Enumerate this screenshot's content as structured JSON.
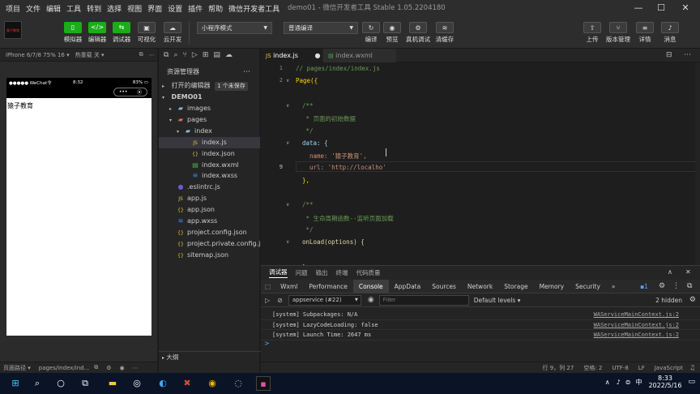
{
  "menu": [
    "项目",
    "文件",
    "编辑",
    "工具",
    "转到",
    "选择",
    "视图",
    "界面",
    "设置",
    "插件",
    "帮助",
    "微信开发者工具"
  ],
  "window_title": "demo01 - 微信开发者工具 Stable 1.05.2204180",
  "window_controls": {
    "minimize": "—",
    "maximize": "☐",
    "close": "✕"
  },
  "toolbar": {
    "logo_text": "猿子教育",
    "simulator": "模拟器",
    "editor": "编辑器",
    "debugger": "调试器",
    "visual": "可视化",
    "cloud": "云开发",
    "mode_select": "小程序模式",
    "compile_select": "普通编译",
    "compile": "编译",
    "preview": "预览",
    "remote_debug": "真机调试",
    "clear_cache": "清缓存",
    "upload": "上传",
    "version": "版本管理",
    "details": "详情",
    "messages": "消息"
  },
  "simulator": {
    "device": "iPhone 6/7/8 75% 16 ▾",
    "hot_reload": "热重载 关 ▾",
    "status_left": "●●●●● WeChat令",
    "status_time": "8:32",
    "status_battery": "83% ▭",
    "capsule_more": "•••",
    "capsule_close": "⦿",
    "content_text": "猿子教育",
    "page_path_label": "页面路径 ▾",
    "page_path": "pages/index/ind..."
  },
  "explorer": {
    "title": "资源管理器",
    "open_editors": "打开的编辑器",
    "unsaved_badge": "1 个未保存",
    "project": "DEMO01",
    "outline": "大纲",
    "items": [
      {
        "name": "images",
        "depth": 1,
        "kind": "folder",
        "arrow": "▸"
      },
      {
        "name": "pages",
        "depth": 1,
        "kind": "folder-red",
        "arrow": "▾"
      },
      {
        "name": "index",
        "depth": 2,
        "kind": "folder",
        "arrow": "▾"
      },
      {
        "name": "index.js",
        "depth": 3,
        "kind": "js",
        "arrow": ""
      },
      {
        "name": "index.json",
        "depth": 3,
        "kind": "json",
        "arrow": ""
      },
      {
        "name": "index.wxml",
        "depth": 3,
        "kind": "wxml",
        "arrow": ""
      },
      {
        "name": "index.wxss",
        "depth": 3,
        "kind": "wxss",
        "arrow": ""
      },
      {
        "name": ".eslintrc.js",
        "depth": 1,
        "kind": "eslint",
        "arrow": ""
      },
      {
        "name": "app.js",
        "depth": 1,
        "kind": "js",
        "arrow": ""
      },
      {
        "name": "app.json",
        "depth": 1,
        "kind": "json",
        "arrow": ""
      },
      {
        "name": "app.wxss",
        "depth": 1,
        "kind": "wxss",
        "arrow": ""
      },
      {
        "name": "project.config.json",
        "depth": 1,
        "kind": "json",
        "arrow": ""
      },
      {
        "name": "project.private.config.js...",
        "depth": 1,
        "kind": "json",
        "arrow": ""
      },
      {
        "name": "sitemap.json",
        "depth": 1,
        "kind": "json",
        "arrow": ""
      }
    ]
  },
  "editor": {
    "tabs": [
      {
        "label": "index.js",
        "active": true,
        "dirty": "●"
      },
      {
        "label": "index.wxml",
        "active": false,
        "dirty": ""
      }
    ],
    "line_numbers": [
      "1",
      "2",
      "",
      "",
      "",
      "",
      "",
      "",
      "9",
      "",
      "",
      "",
      "",
      "",
      "",
      "",
      ""
    ],
    "lines": [
      {
        "text": "// pages/index/index.js",
        "cls": "c-cm",
        "indent": 0
      },
      {
        "text": "Page({",
        "cls": "c-y",
        "indent": 0
      },
      {
        "text": "",
        "cls": "",
        "indent": 0
      },
      {
        "text": "/**",
        "cls": "c-cm",
        "indent": 1
      },
      {
        "text": " * 页面的初始数据",
        "cls": "c-cm",
        "indent": 1
      },
      {
        "text": " */",
        "cls": "c-cm",
        "indent": 1
      },
      {
        "text": "data: {",
        "cls": "c-key",
        "indent": 1
      },
      {
        "text": "name: '猿子教育',",
        "cls": "c-str",
        "indent": 2
      },
      {
        "text": "url: 'http://localho'",
        "cls": "c-str",
        "indent": 2
      },
      {
        "text": "},",
        "cls": "c-y",
        "indent": 1
      },
      {
        "text": "",
        "cls": "",
        "indent": 0
      },
      {
        "text": "/**",
        "cls": "c-cm",
        "indent": 1
      },
      {
        "text": " * 生命周期函数--监听页面加载",
        "cls": "c-cm",
        "indent": 1
      },
      {
        "text": " */",
        "cls": "c-cm",
        "indent": 1
      },
      {
        "text": "onLoad(options) {",
        "cls": "c-fn",
        "indent": 1
      },
      {
        "text": "",
        "cls": "",
        "indent": 0
      },
      {
        "text": "},",
        "cls": "c-y",
        "indent": 1
      }
    ]
  },
  "console": {
    "panel_tabs": [
      "调试器",
      "问题",
      "输出",
      "终端",
      "代码质量"
    ],
    "devtools_tabs": [
      "Wxml",
      "Performance",
      "Console",
      "AppData",
      "Sources",
      "Network",
      "Storage",
      "Memory",
      "Security",
      "»"
    ],
    "issues_count": "1",
    "context_select": "appservice (#22)",
    "filter_placeholder": "Filter",
    "levels": "Default levels ▾",
    "hidden": "2 hidden",
    "rows": [
      {
        "msg": "[system] Subpackages: N/A",
        "src": "WAServiceMainContext.js:2"
      },
      {
        "msg": "[system] LazyCodeLoading: false",
        "src": "WAServiceMainContext.js:2"
      },
      {
        "msg": "[system] Launch Time: 2647 ms",
        "src": "WAServiceMainContext.js:2"
      }
    ],
    "prompt": ">"
  },
  "statusbar": {
    "position": "行 9，列 27",
    "spaces": "空格: 2",
    "encoding": "UTF-8",
    "eol": "LF",
    "language": "JavaScript"
  },
  "taskbar": {
    "time": "8:33",
    "date": "2022/5/16",
    "ime": "中",
    "tray_arrow": "∧"
  }
}
